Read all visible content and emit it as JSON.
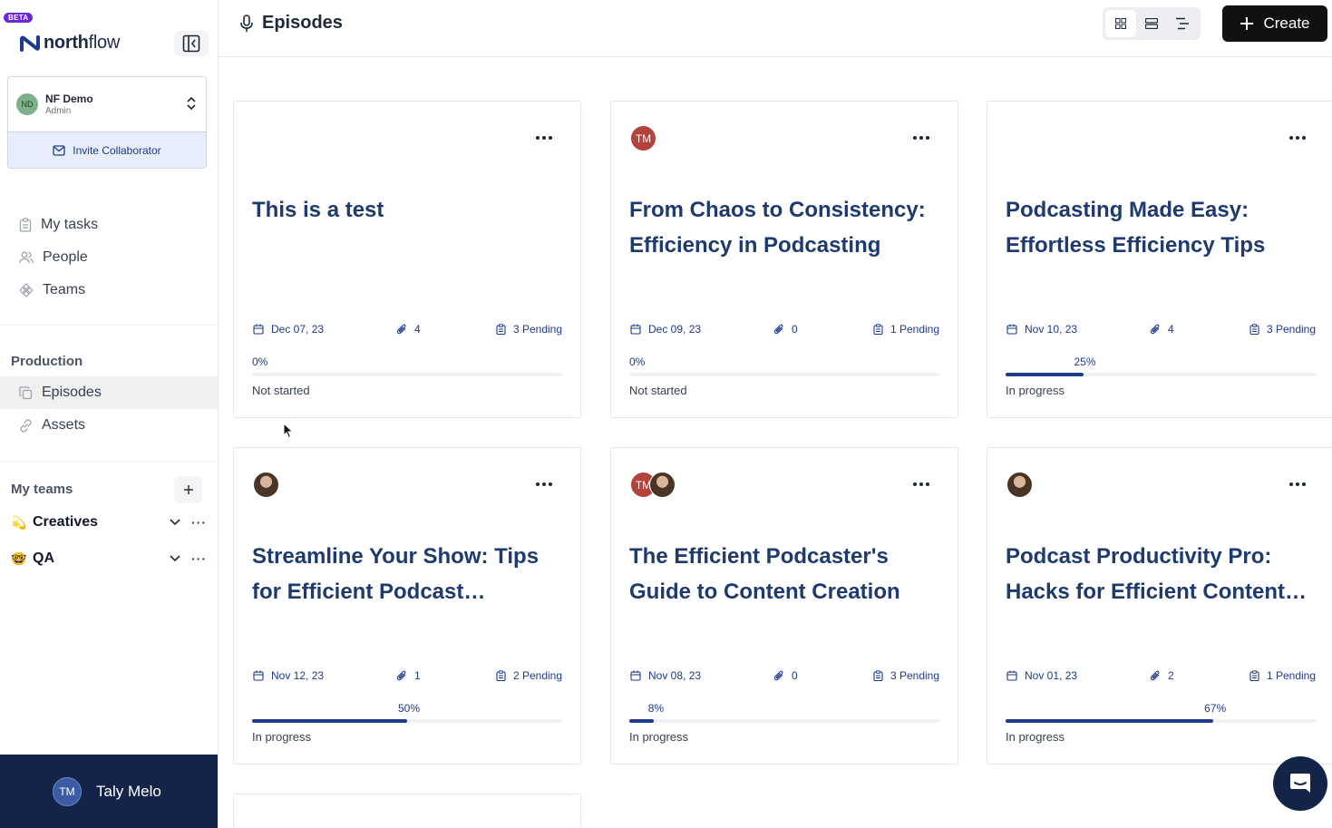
{
  "app": {
    "beta_badge": "BETA",
    "logo_bold": "north",
    "logo_light": "flow"
  },
  "workspace": {
    "initials": "ND",
    "name": "NF Demo",
    "role": "Admin",
    "invite_label": "Invite Collaborator"
  },
  "nav": {
    "my_tasks": "My tasks",
    "people": "People",
    "teams": "Teams"
  },
  "production": {
    "label": "Production",
    "episodes": "Episodes",
    "assets": "Assets"
  },
  "my_teams": {
    "label": "My teams",
    "teams": [
      {
        "emoji": "💫",
        "name": "Creatives"
      },
      {
        "emoji": "🤓",
        "name": "QA"
      }
    ]
  },
  "user": {
    "initials": "TM",
    "name": "Taly Melo"
  },
  "header": {
    "title": "Episodes",
    "create_label": "Create"
  },
  "cards": [
    {
      "title": "This is a test",
      "date": "Dec 07, 23",
      "attachments": "4",
      "pending": "3 Pending",
      "progress": 0,
      "progress_label": "0%",
      "status": "Not started"
    },
    {
      "title": "From Chaos to Consistency: Efficiency in Podcasting",
      "avatar": "TM",
      "date": "Dec 09, 23",
      "attachments": "0",
      "pending": "1 Pending",
      "progress": 0,
      "progress_label": "0%",
      "status": "Not started"
    },
    {
      "title": "Podcasting Made Easy: Effortless Efficiency Tips",
      "date": "Nov 10, 23",
      "attachments": "4",
      "pending": "3 Pending",
      "progress": 25,
      "progress_label": "25%",
      "status": "In progress"
    },
    {
      "title": "Streamline Your Show: Tips for Efficient Podcast Production",
      "date": "Nov 12, 23",
      "attachments": "1",
      "pending": "2 Pending",
      "progress": 50,
      "progress_label": "50%",
      "status": "In progress"
    },
    {
      "title": "The Efficient Podcaster's Guide to Content Creation",
      "avatar": "TM",
      "date": "Nov 08, 23",
      "attachments": "0",
      "pending": "3 Pending",
      "progress": 8,
      "progress_label": "8%",
      "status": "In progress"
    },
    {
      "title": "Podcast Productivity Pro: Hacks for Efficient Content Creation",
      "date": "Nov 01, 23",
      "attachments": "2",
      "pending": "1 Pending",
      "progress": 67,
      "progress_label": "67%",
      "status": "In progress"
    }
  ],
  "colors": {
    "brand_navy": "#142449",
    "accent_blue": "#1e3a8a",
    "title_blue": "#1e3a6e",
    "beta_purple": "#6d28d9"
  }
}
